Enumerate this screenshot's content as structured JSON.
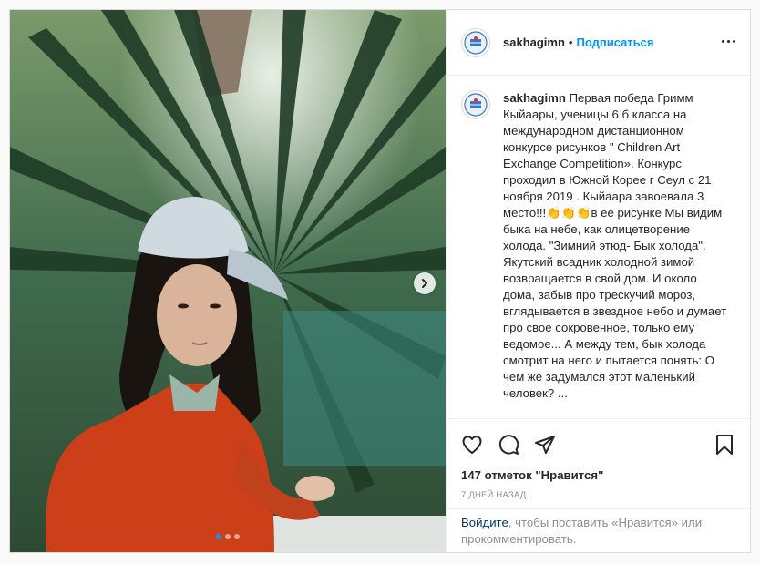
{
  "post": {
    "username": "sakhagimn",
    "follow_label": "Подписаться",
    "bullet": "•",
    "caption": "Первая победа Гримм Кыйаары, ученицы 6 б класса на международном дистанционном конкурсе рисунков \" Children Art Exchange Competition». Конкурс проходил в Южной Корее г Сеул с 21 ноября 2019 . Кыйаара завоевала 3 место!!!👏👏👏в ее рисунке Мы видим быка на небе, как олицетворение холода. \"Зимний этюд- Бык холода\". Якутский всадник холодной зимой возвращается в свой дом. И около дома, забыв про трескучий мороз, вглядывается в звездное небо и думает про свое сокровенное, только ему ведомое... А между тем, бык холода смотрит на него и пытается понять: О чем же задумался этот маленький человек? ...",
    "likes": "147 отметок \"Нравится\"",
    "date": "7 дней назад",
    "login_link": "Войдите",
    "login_text": ", чтобы поставить «Нравится» или прокомментировать.",
    "carousel": {
      "total": 3,
      "active": 1
    }
  },
  "icons": {
    "more": "more-options-icon",
    "next": "chevron-right-icon",
    "like": "heart-icon",
    "comment": "comment-icon",
    "share": "paper-plane-icon",
    "save": "bookmark-icon"
  },
  "colors": {
    "link": "#0095f6",
    "login_link": "#00376b",
    "muted": "#8e8e8e",
    "carousel_active": "#1a91e8"
  }
}
